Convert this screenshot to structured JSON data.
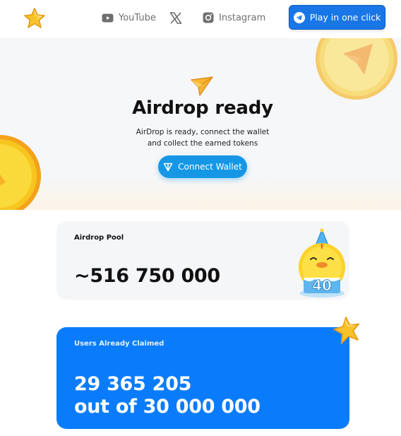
{
  "header": {
    "nav": {
      "youtube": "YouTube",
      "instagram": "Instagram"
    },
    "play_button": "Play in one click"
  },
  "hero": {
    "title": "Airdrop ready",
    "subtitle_line1": "AirDrop is ready, connect the wallet",
    "subtitle_line2": "and collect the earned tokens",
    "connect_button": "Connect Wallet"
  },
  "cards": {
    "pool": {
      "label": "Airdrop Pool",
      "value": "~516 750 000"
    },
    "users": {
      "label": "Users Already Claimed",
      "value_line1": "29 365 205",
      "value_line2": "out of 30 000 000"
    }
  },
  "icons": {
    "logo": "star-logo-icon",
    "youtube": "youtube-icon",
    "x": "x-icon",
    "instagram": "instagram-icon",
    "telegram": "telegram-icon",
    "ton": "ton-icon"
  },
  "colors": {
    "primary_blue": "#0a7cfb",
    "button_blue": "#1976e6",
    "connect_blue": "#1597e6",
    "coin_gold": "#f5c21b"
  }
}
